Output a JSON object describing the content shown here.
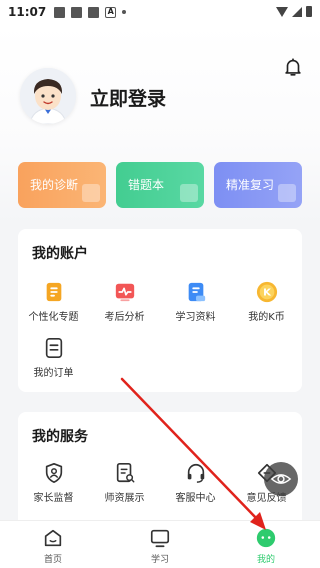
{
  "status_bar": {
    "time": "11:07",
    "extra_icon": "A"
  },
  "header": {
    "login_text": "立即登录"
  },
  "quick_actions": [
    {
      "label": "我的诊断",
      "color": "#f9a25d"
    },
    {
      "label": "错题本",
      "color": "#43cd91"
    },
    {
      "label": "精准复习",
      "color": "#7d8ff3"
    }
  ],
  "account": {
    "title": "我的账户",
    "items": [
      {
        "label": "个性化专题",
        "icon": "document-stack-icon",
        "color": "#f5a623"
      },
      {
        "label": "考后分析",
        "icon": "chart-pulse-icon",
        "color": "#f25656"
      },
      {
        "label": "学习资料",
        "icon": "study-materials-icon",
        "color": "#3d8bf5"
      },
      {
        "label": "我的K币",
        "icon": "k-coin-icon",
        "color": "#f7b731"
      },
      {
        "label": "我的订单",
        "icon": "order-list-icon",
        "color": "#333333"
      }
    ]
  },
  "services": {
    "title": "我的服务",
    "items": [
      {
        "label": "家长监督",
        "icon": "parent-supervision-icon"
      },
      {
        "label": "师资展示",
        "icon": "teacher-showcase-icon"
      },
      {
        "label": "客服中心",
        "icon": "headset-icon"
      },
      {
        "label": "意见反馈",
        "icon": "feedback-icon"
      }
    ]
  },
  "tab_bar": {
    "items": [
      {
        "label": "首页",
        "icon": "home-icon",
        "active": false
      },
      {
        "label": "学习",
        "icon": "study-screen-icon",
        "active": false
      },
      {
        "label": "我的",
        "icon": "profile-smile-icon",
        "active": true
      }
    ],
    "active_color": "#2ecb6e"
  },
  "annotation_color": "#e0231c"
}
